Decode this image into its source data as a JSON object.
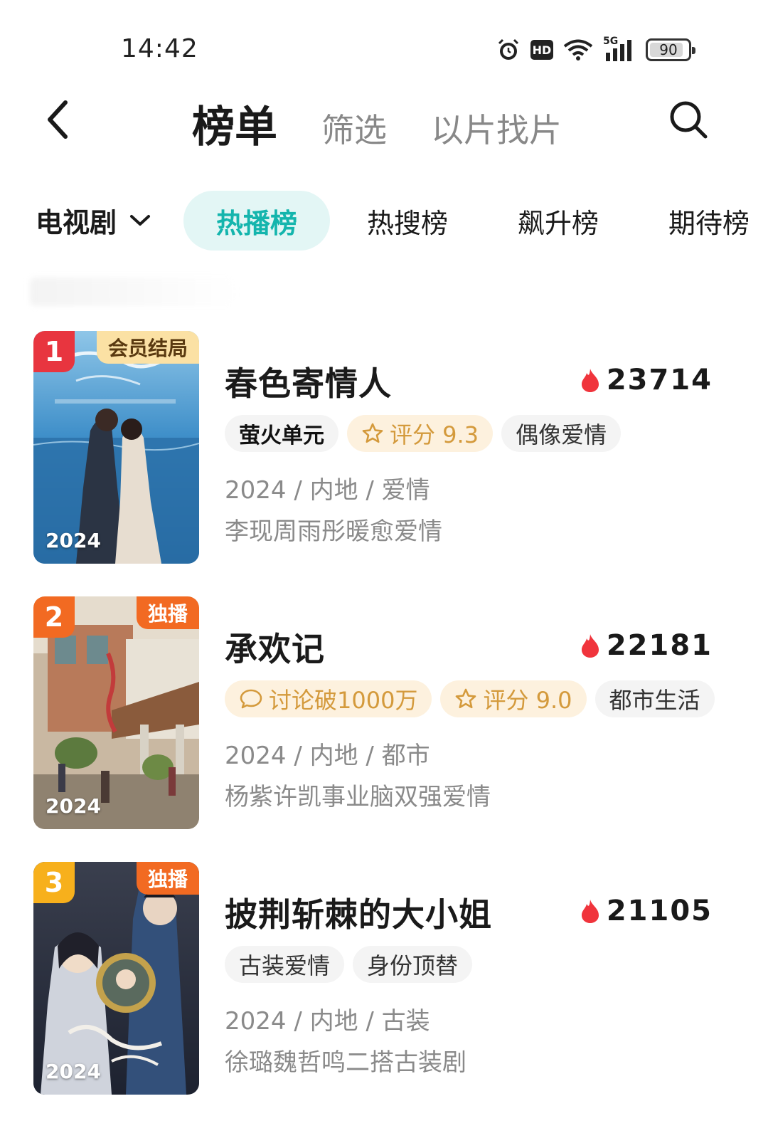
{
  "status_bar": {
    "time": "14:42",
    "network": "5G",
    "hd": "HD",
    "battery": "90",
    "battery_level": 0.9,
    "icons": [
      "alarm-icon",
      "hd-icon",
      "wifi-icon",
      "signal-icon",
      "battery-icon"
    ]
  },
  "header": {
    "back_icon": "chevron-left-icon",
    "tabs": [
      {
        "label": "榜单",
        "active": true
      },
      {
        "label": "筛选",
        "active": false
      },
      {
        "label": "以片找片",
        "active": false
      }
    ],
    "search_icon": "search-icon"
  },
  "category": {
    "selected": "电视剧",
    "rank_tabs": [
      {
        "label": "热播榜",
        "active": true
      },
      {
        "label": "热搜榜",
        "active": false
      },
      {
        "label": "飙升榜",
        "active": false
      },
      {
        "label": "期待榜",
        "active": false
      }
    ]
  },
  "colors": {
    "accent": "#14b5ad",
    "accent_bg": "#e3f6f5",
    "rank1": "#e8353f",
    "rank2": "#f26a22",
    "rank3": "#f7b01c",
    "heat": "#f0343c",
    "warm_tag_text": "#d49a3c",
    "warm_tag_bg": "#fdf1de"
  },
  "items": [
    {
      "rank": "1",
      "badge": "会员结局",
      "year": "2024",
      "title": "春色寄情人",
      "heat": "23714",
      "tags": [
        {
          "text": "萤火单元",
          "icon": "",
          "style": "brand"
        },
        {
          "text": "评分 9.3",
          "icon": "star-icon",
          "style": "warm"
        },
        {
          "text": "偶像爱情",
          "icon": "",
          "style": "plain"
        }
      ],
      "meta": "2024 / 内地 / 爱情",
      "desc": "李现周雨彤暖愈爱情"
    },
    {
      "rank": "2",
      "badge": "独播",
      "year": "2024",
      "title": "承欢记",
      "heat": "22181",
      "tags": [
        {
          "text": "讨论破1000万",
          "icon": "comment-icon",
          "style": "warm"
        },
        {
          "text": "评分 9.0",
          "icon": "star-icon",
          "style": "warm"
        },
        {
          "text": "都市生活",
          "icon": "",
          "style": "plain"
        }
      ],
      "meta": "2024 / 内地 / 都市",
      "desc": "杨紫许凯事业脑双强爱情"
    },
    {
      "rank": "3",
      "badge": "独播",
      "year": "2024",
      "title": "披荆斩棘的大小姐",
      "heat": "21105",
      "tags": [
        {
          "text": "古装爱情",
          "icon": "",
          "style": "plain"
        },
        {
          "text": "身份顶替",
          "icon": "",
          "style": "plain"
        }
      ],
      "meta": "2024 / 内地 / 古装",
      "desc": "徐璐魏哲鸣二搭古装剧"
    }
  ]
}
